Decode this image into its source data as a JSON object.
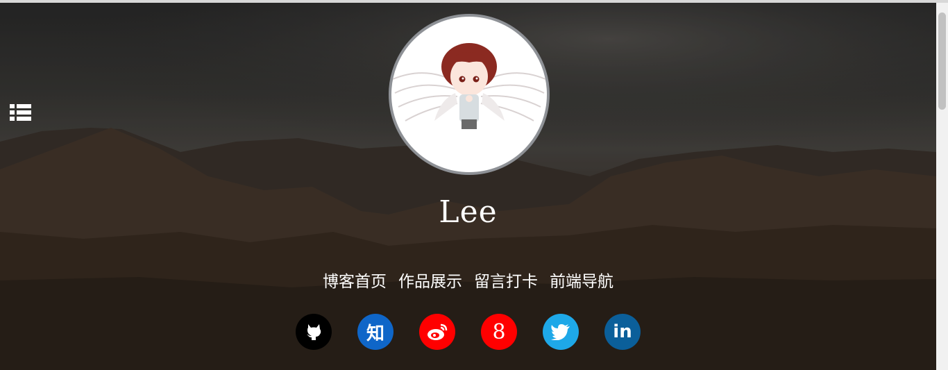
{
  "profile": {
    "name": "Lee",
    "avatar_alt": "avatar"
  },
  "nav": {
    "items": [
      "博客首页",
      "作品展示",
      "留言打卡",
      "前端导航"
    ]
  },
  "social": [
    {
      "name": "github",
      "icon": "github-icon",
      "color": "#000000"
    },
    {
      "name": "zhihu",
      "icon": "zhihu-icon",
      "glyph": "知",
      "color": "#0f66c8"
    },
    {
      "name": "weibo",
      "icon": "weibo-icon",
      "color": "#ff0000"
    },
    {
      "name": "google",
      "icon": "google-icon",
      "glyph": "8",
      "color": "#ff0000"
    },
    {
      "name": "twitter",
      "icon": "twitter-icon",
      "color": "#1ea8e8"
    },
    {
      "name": "linkedin",
      "icon": "linkedin-icon",
      "glyph": "in",
      "color": "#0b5f9a"
    }
  ],
  "colors": {
    "text": "#ffffff",
    "avatar_border": "#8e9196"
  }
}
